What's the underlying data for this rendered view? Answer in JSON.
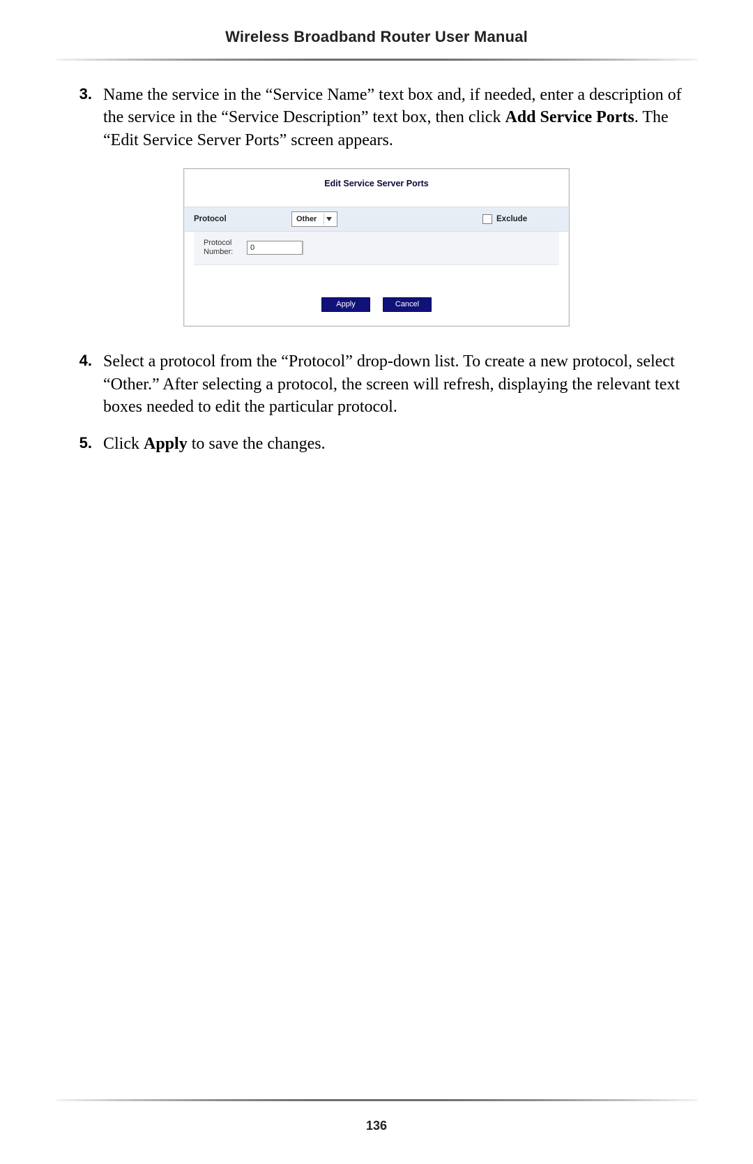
{
  "header": {
    "title": "Wireless Broadband Router User Manual"
  },
  "steps": {
    "s3": {
      "num": "3.",
      "pre": "Name the service in the “Service Name” text box and, if needed, enter a description of the service in the “Service Description” text box, then click ",
      "bold": "Add Service Ports",
      "post": ". The “Edit Service Server Ports” screen appears."
    },
    "s4": {
      "num": "4.",
      "text": "Select a protocol from the “Protocol” drop-down list. To create a new protocol, select “Other.” After selecting a protocol, the screen will refresh, displaying the relevant text boxes needed to edit the particular protocol."
    },
    "s5": {
      "num": "5.",
      "pre": "Click ",
      "bold": "Apply",
      "post": " to save the changes."
    }
  },
  "screenshot": {
    "title": "Edit Service Server Ports",
    "protocol_label": "Protocol",
    "protocol_value": "Other",
    "exclude_label": "Exclude",
    "protocol_number_label": "Protocol Number:",
    "protocol_number_value": "0",
    "apply": "Apply",
    "cancel": "Cancel"
  },
  "footer": {
    "page": "136"
  }
}
